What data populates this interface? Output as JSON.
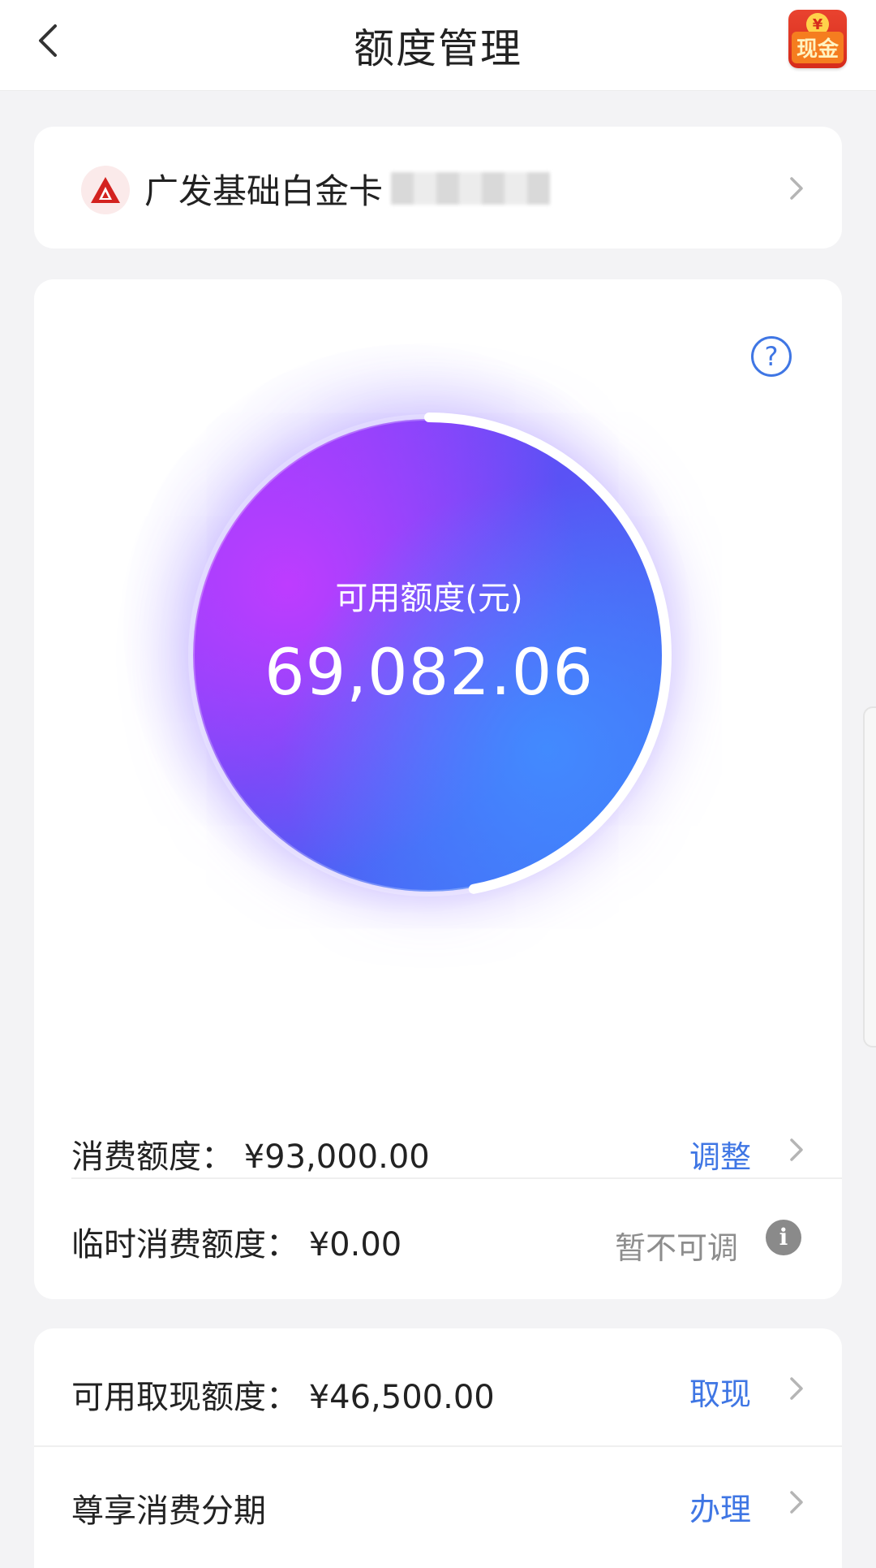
{
  "header": {
    "title": "额度管理",
    "cash_badge_coin": "¥",
    "cash_badge_label": "现金"
  },
  "card_selector": {
    "card_name": "广发基础白金卡"
  },
  "limit": {
    "available_label": "可用额度(元)",
    "available_value": "69,082.06",
    "help_symbol": "?"
  },
  "rows": {
    "spending_limit": {
      "label": "消费额度：  ¥93,000.00",
      "action": "调整"
    },
    "temp_limit": {
      "label": "临时消费额度：  ¥0.00",
      "action": "暂不可调",
      "info_symbol": "i"
    },
    "cash_limit": {
      "label": "可用取现额度：  ¥46,500.00",
      "action": "取现"
    },
    "installment": {
      "label": "尊享消费分期",
      "action": "办理"
    }
  },
  "colors": {
    "accent_blue": "#3f76e4",
    "bank_red": "#d3221f",
    "orb_purple": "#9b3cff",
    "orb_blue": "#3a7cf6"
  },
  "icons": {
    "back": "chevron-left-icon",
    "chevron": "chevron-right-icon",
    "help": "question-circle-icon",
    "info": "info-circle-icon",
    "bank_logo": "cgb-bank-logo-icon"
  }
}
